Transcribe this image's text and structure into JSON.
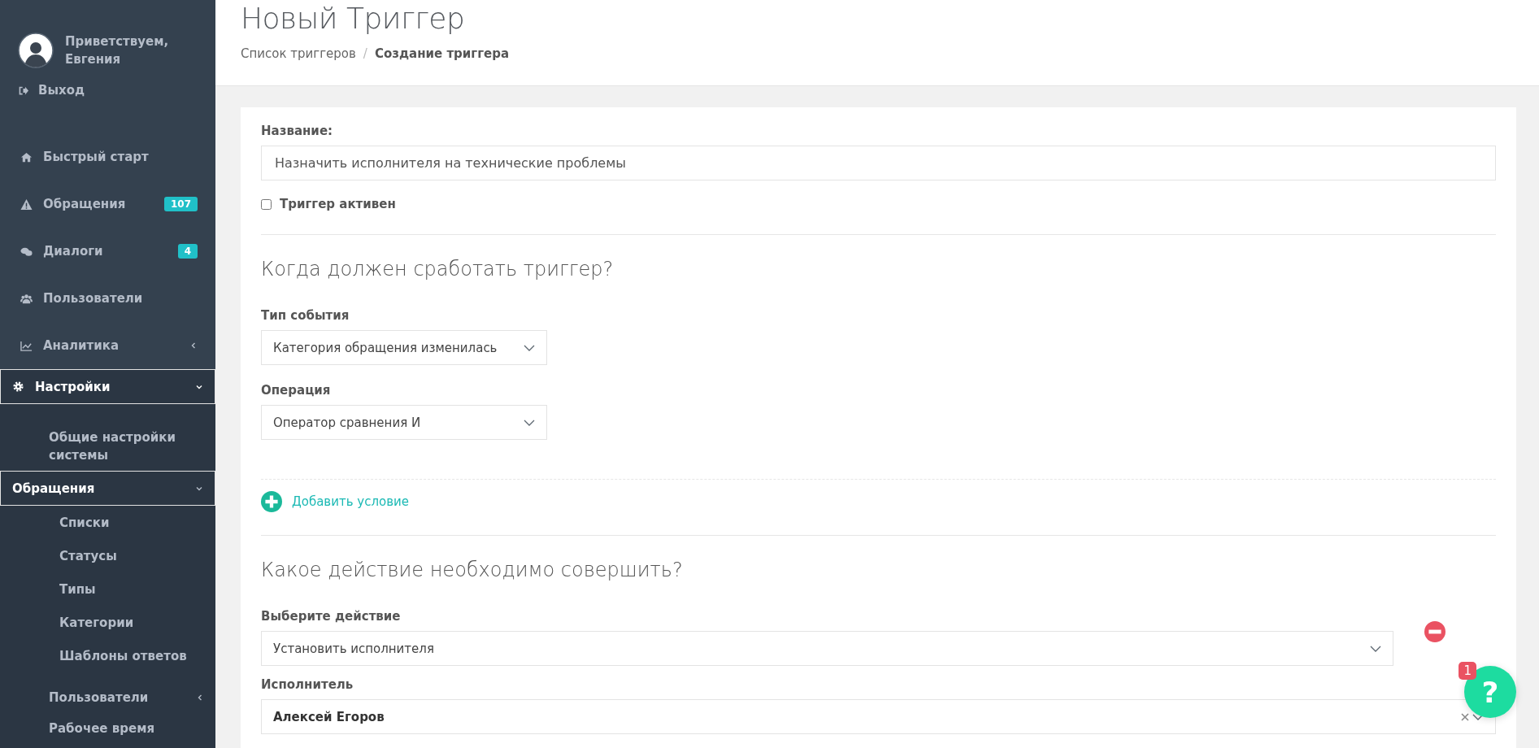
{
  "sidebar": {
    "greeting": "Приветствуем, Евгения",
    "logout": "Выход",
    "items": [
      {
        "label": "Быстрый старт",
        "selected": false
      },
      {
        "label": "Обращения",
        "badge": "107",
        "selected": false
      },
      {
        "label": "Диалоги",
        "badge": "4",
        "selected": false
      },
      {
        "label": "Пользователи",
        "selected": false
      },
      {
        "label": "Аналитика",
        "expanded": false,
        "selected": false
      },
      {
        "label": "Настройки",
        "expanded": true,
        "selected": true,
        "children": [
          {
            "label": "Общие настройки системы",
            "selected": false
          },
          {
            "label": "Обращения",
            "expanded": true,
            "selected": true,
            "children": [
              {
                "label": "Списки",
                "selected": false
              },
              {
                "label": "Статусы",
                "selected": false
              },
              {
                "label": "Типы",
                "selected": false
              },
              {
                "label": "Категории",
                "selected": false
              },
              {
                "label": "Шаблоны ответов",
                "selected": false
              }
            ]
          },
          {
            "label": "Пользователи",
            "expanded": false,
            "selected": false
          },
          {
            "label": "Рабочее время",
            "selected": false
          }
        ]
      }
    ]
  },
  "page": {
    "title": "Новый Триггер",
    "breadcrumb_separator": "/",
    "breadcrumb": [
      {
        "label": "Список триггеров",
        "current": false
      },
      {
        "label": "Создание триггера",
        "current": true
      }
    ]
  },
  "form": {
    "name_label": "Название:",
    "name_value": "Назначить исполнителя на технические проблемы",
    "active": {
      "label": "Триггер активен",
      "checked": false
    },
    "when_heading": "Когда должен сработать триггер?",
    "event_label": "Тип события",
    "event_value": "Категория обращения изменилась",
    "operation_label": "Операция",
    "operation_value": "Оператор сравнения И",
    "add_condition": "Добавить условие",
    "action_heading": "Какое действие необходимо совершить?",
    "action_label": "Выберите действие",
    "action_value": "Установить исполнителя",
    "assignee_label": "Исполнитель",
    "assignee_value": "Алексей Егоров"
  },
  "help": {
    "label": "?",
    "badge": "1"
  }
}
